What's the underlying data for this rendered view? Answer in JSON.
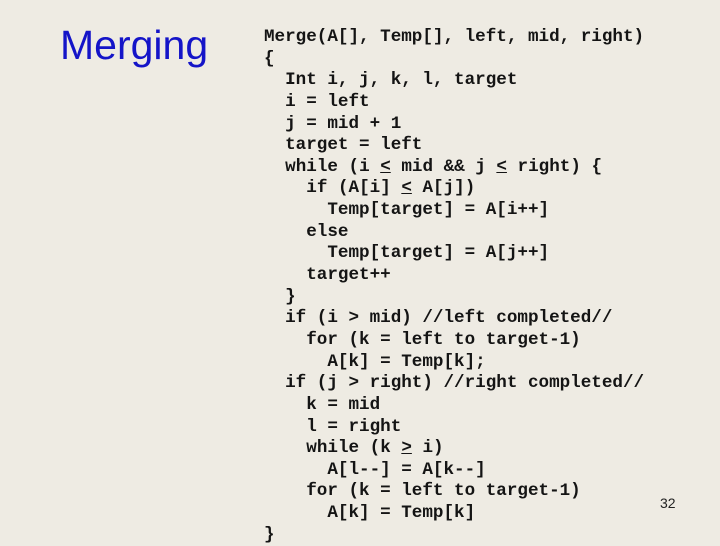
{
  "slide": {
    "title": "Merging",
    "page_number": "32",
    "title_color": "#1414c8",
    "background_color": "#eeebe3"
  },
  "code": {
    "lines": [
      "Merge(A[], Temp[], left, mid, right)",
      "{",
      "  Int i, j, k, l, target",
      "  i = left",
      "  j = mid + 1",
      "  target = left",
      "  while (i < mid && j < right) {",
      "    if (A[i] < A[j])",
      "      Temp[target] = A[i++]",
      "    else",
      "      Temp[target] = A[j++]",
      "    target++",
      "  }",
      "  if (i > mid) //left completed//",
      "    for (k = left to target-1)",
      "      A[k] = Temp[k];",
      "  if (j > right) //right completed//",
      "    k = mid",
      "    l = right",
      "    while (k > i)",
      "      A[l--] = A[k--]",
      "    for (k = left to target-1)",
      "      A[k] = Temp[k]",
      "}"
    ],
    "underlined_operators_note": "'<' in while and if conditions and '>' in 'while (k > i)' are underlined (≤ / ≥)"
  }
}
